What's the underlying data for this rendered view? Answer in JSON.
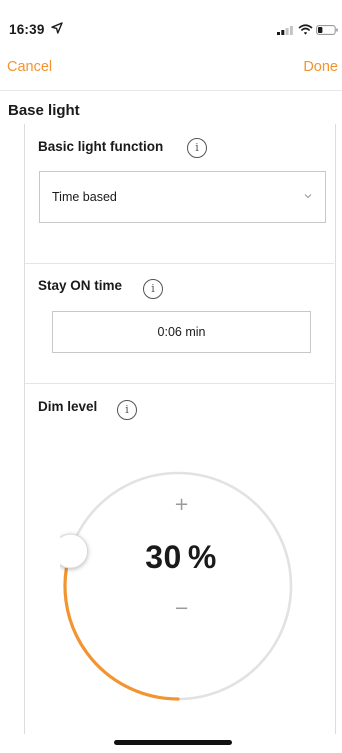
{
  "status_bar": {
    "time": "16:39"
  },
  "nav": {
    "cancel_label": "Cancel",
    "done_label": "Done"
  },
  "page": {
    "title": "Base light"
  },
  "basic_light_function": {
    "title": "Basic light function",
    "info_glyph": "i",
    "selected": "Time based"
  },
  "stay_on_time": {
    "title": "Stay ON time",
    "info_glyph": "i",
    "value": "0:06 min"
  },
  "dim_level": {
    "title": "Dim level",
    "info_glyph": "i",
    "value": "30",
    "unit": "%",
    "level_percent": 30,
    "plus_label": "+",
    "minus_label": "−"
  },
  "colors": {
    "accent": "#f29430",
    "track": "#e2e2e2"
  },
  "icons": [
    "location-arrow-icon",
    "signal-icon",
    "wifi-icon",
    "battery-icon",
    "info-icon",
    "chevron-down-icon",
    "slider-knob"
  ]
}
